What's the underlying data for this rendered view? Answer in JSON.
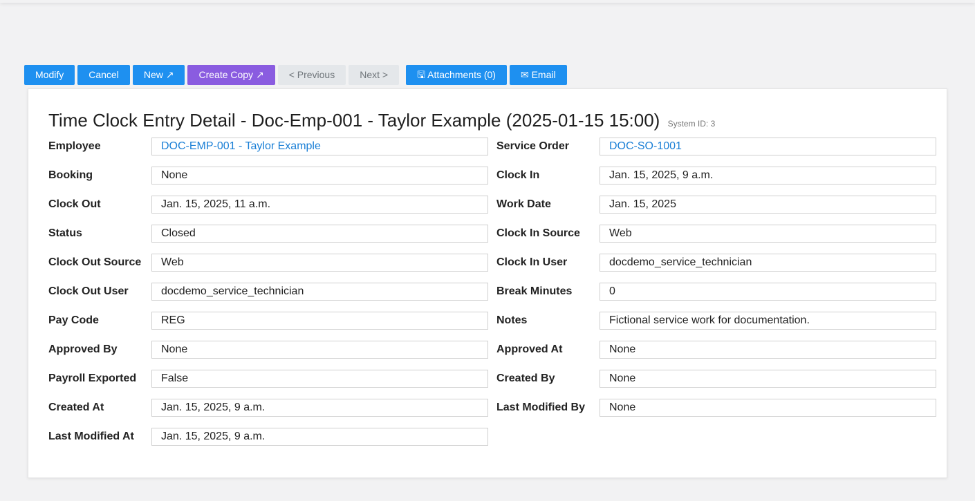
{
  "toolbar": {
    "modify": "Modify",
    "cancel": "Cancel",
    "new": "New ↗",
    "create_copy": "Create Copy ↗",
    "previous": "< Previous",
    "next": "Next >",
    "attachments": "🖫 Attachments (0)",
    "email": "✉ Email"
  },
  "detail": {
    "title": "Time Clock Entry Detail - Doc-Emp-001 - Taylor Example (2025-01-15 15:00)",
    "system_id": "System ID: 3",
    "left": [
      {
        "label": "Employee",
        "value": "DOC-EMP-001 - Taylor Example"
      },
      {
        "label": "Booking",
        "value": "None"
      },
      {
        "label": "Clock Out",
        "value": "Jan. 15, 2025, 11 a.m."
      },
      {
        "label": "Status",
        "value": "Closed"
      },
      {
        "label": "Clock Out Source",
        "value": "Web"
      },
      {
        "label": "Clock Out User",
        "value": "docdemo_service_technician"
      },
      {
        "label": "Pay Code",
        "value": "REG"
      },
      {
        "label": "Approved By",
        "value": "None"
      },
      {
        "label": "Payroll Exported",
        "value": "False"
      },
      {
        "label": "Created At",
        "value": "Jan. 15, 2025, 9 a.m."
      },
      {
        "label": "Last Modified At",
        "value": "Jan. 15, 2025, 9 a.m."
      }
    ],
    "right": [
      {
        "label": "Service Order",
        "value": "DOC-SO-1001"
      },
      {
        "label": "Clock In",
        "value": "Jan. 15, 2025, 9 a.m."
      },
      {
        "label": "Work Date",
        "value": "Jan. 15, 2025"
      },
      {
        "label": "Clock In Source",
        "value": "Web"
      },
      {
        "label": "Clock In User",
        "value": "docdemo_service_technician"
      },
      {
        "label": "Break Minutes",
        "value": "0"
      },
      {
        "label": "Notes",
        "value": "Fictional service work for documentation."
      },
      {
        "label": "Approved At",
        "value": "None"
      },
      {
        "label": "Created By",
        "value": "None"
      },
      {
        "label": "Last Modified By",
        "value": "None"
      }
    ]
  },
  "colors": {
    "primary": "#1e90f0",
    "purple": "#8a5ce0",
    "disabled": "#e4e7ea",
    "link": "#1a7fd6"
  }
}
